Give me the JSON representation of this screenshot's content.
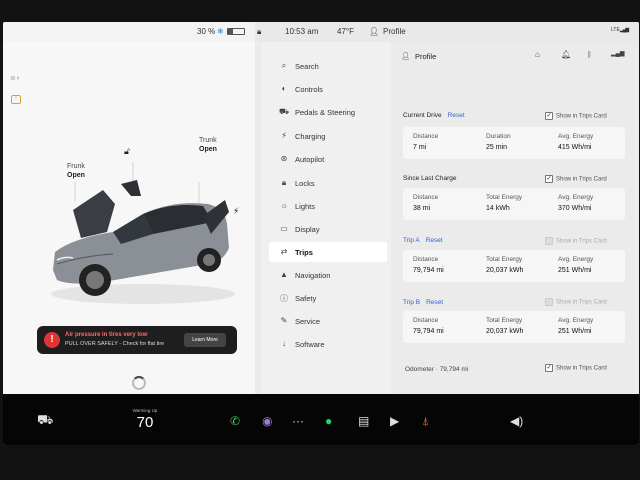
{
  "status_bar": {
    "battery_percent": "30 %",
    "battery_level": 0.3,
    "snowflake_icon": "snowflake-icon",
    "time": "10:53 am",
    "temperature": "47°F",
    "profile_label": "Profile",
    "lte_label": "LTE"
  },
  "car": {
    "frunk": {
      "title": "Frunk",
      "state": "Open"
    },
    "trunk": {
      "title": "Trunk",
      "state": "Open"
    },
    "alert": {
      "title": "Air pressure in tires very low",
      "subtitle": "PULL OVER SAFELY - Check for flat tire",
      "button": "Learn More"
    }
  },
  "menu": {
    "items": [
      {
        "label": "Search",
        "icon": "search-icon"
      },
      {
        "label": "Controls",
        "icon": "toggle-icon"
      },
      {
        "label": "Pedals & Steering",
        "icon": "car-icon"
      },
      {
        "label": "Charging",
        "icon": "bolt-icon"
      },
      {
        "label": "Autopilot",
        "icon": "steering-wheel-icon"
      },
      {
        "label": "Locks",
        "icon": "lock-icon"
      },
      {
        "label": "Lights",
        "icon": "sun-icon"
      },
      {
        "label": "Display",
        "icon": "display-icon"
      },
      {
        "label": "Trips",
        "icon": "trips-icon",
        "active": true
      },
      {
        "label": "Navigation",
        "icon": "navigation-icon"
      },
      {
        "label": "Safety",
        "icon": "safety-icon"
      },
      {
        "label": "Service",
        "icon": "wrench-icon"
      },
      {
        "label": "Software",
        "icon": "download-icon"
      }
    ]
  },
  "trips": {
    "profile_label": "Profile",
    "show_label": "Show in Trips Card",
    "reset_label": "Reset",
    "col_distance": "Distance",
    "col_duration": "Duration",
    "col_total_energy": "Total Energy",
    "col_avg_energy": "Avg. Energy",
    "current_drive": {
      "title": "Current Drive",
      "distance": "7 mi",
      "duration": "25 min",
      "avg_energy": "415 Wh/mi",
      "show_checked": true
    },
    "since_last_charge": {
      "title": "Since Last Charge",
      "distance": "38 mi",
      "total_energy": "14 kWh",
      "avg_energy": "370 Wh/mi",
      "show_checked": true
    },
    "trip_a": {
      "title": "Trip A",
      "distance": "79,794 mi",
      "total_energy": "20,037 kWh",
      "avg_energy": "251 Wh/mi",
      "show_checked": false
    },
    "trip_b": {
      "title": "Trip B",
      "distance": "79,794 mi",
      "total_energy": "20,037 kWh",
      "avg_energy": "251 Wh/mi",
      "show_checked": false
    },
    "odometer_label": "Odometer",
    "odometer_value": "79,794 mi",
    "odometer_show_checked": true
  },
  "dock": {
    "speed_caption": "Warming Up",
    "speed_value": "70"
  }
}
